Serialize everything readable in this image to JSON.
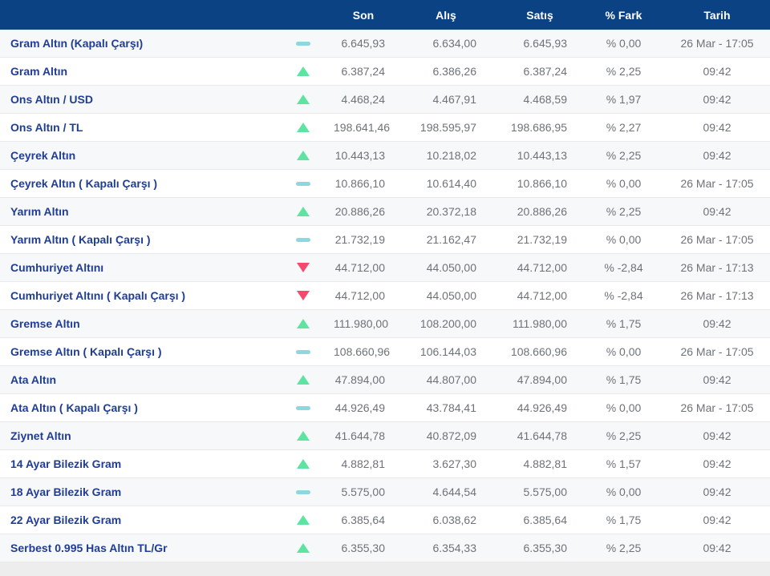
{
  "table": {
    "columns": [
      "Son",
      "Alış",
      "Satış",
      "% Fark",
      "Tarih"
    ],
    "trend_icons": {
      "up": "triangle-up",
      "down": "triangle-down",
      "flat": "dash"
    },
    "rows": [
      {
        "name": "Gram Altın (Kapalı Çarşı)",
        "trend": "flat",
        "son": "6.645,93",
        "alis": "6.634,00",
        "satis": "6.645,93",
        "fark": "% 0,00",
        "tarih": "26 Mar - 17:05"
      },
      {
        "name": "Gram Altın",
        "trend": "up",
        "son": "6.387,24",
        "alis": "6.386,26",
        "satis": "6.387,24",
        "fark": "% 2,25",
        "tarih": "09:42"
      },
      {
        "name": "Ons Altın / USD",
        "trend": "up",
        "son": "4.468,24",
        "alis": "4.467,91",
        "satis": "4.468,59",
        "fark": "% 1,97",
        "tarih": "09:42"
      },
      {
        "name": "Ons Altın / TL",
        "trend": "up",
        "son": "198.641,46",
        "alis": "198.595,97",
        "satis": "198.686,95",
        "fark": "% 2,27",
        "tarih": "09:42"
      },
      {
        "name": "Çeyrek Altın",
        "trend": "up",
        "son": "10.443,13",
        "alis": "10.218,02",
        "satis": "10.443,13",
        "fark": "% 2,25",
        "tarih": "09:42"
      },
      {
        "name": "Çeyrek Altın ( Kapalı Çarşı )",
        "trend": "flat",
        "son": "10.866,10",
        "alis": "10.614,40",
        "satis": "10.866,10",
        "fark": "% 0,00",
        "tarih": "26 Mar - 17:05"
      },
      {
        "name": "Yarım Altın",
        "trend": "up",
        "son": "20.886,26",
        "alis": "20.372,18",
        "satis": "20.886,26",
        "fark": "% 2,25",
        "tarih": "09:42"
      },
      {
        "name": "Yarım Altın ( Kapalı Çarşı )",
        "trend": "flat",
        "son": "21.732,19",
        "alis": "21.162,47",
        "satis": "21.732,19",
        "fark": "% 0,00",
        "tarih": "26 Mar - 17:05"
      },
      {
        "name": "Cumhuriyet Altını",
        "trend": "down",
        "son": "44.712,00",
        "alis": "44.050,00",
        "satis": "44.712,00",
        "fark": "% -2,84",
        "tarih": "26 Mar - 17:13"
      },
      {
        "name": "Cumhuriyet Altını ( Kapalı Çarşı )",
        "trend": "down",
        "son": "44.712,00",
        "alis": "44.050,00",
        "satis": "44.712,00",
        "fark": "% -2,84",
        "tarih": "26 Mar - 17:13"
      },
      {
        "name": "Gremse Altın",
        "trend": "up",
        "son": "111.980,00",
        "alis": "108.200,00",
        "satis": "111.980,00",
        "fark": "% 1,75",
        "tarih": "09:42"
      },
      {
        "name": "Gremse Altın ( Kapalı Çarşı )",
        "trend": "flat",
        "son": "108.660,96",
        "alis": "106.144,03",
        "satis": "108.660,96",
        "fark": "% 0,00",
        "tarih": "26 Mar - 17:05"
      },
      {
        "name": "Ata Altın",
        "trend": "up",
        "son": "47.894,00",
        "alis": "44.807,00",
        "satis": "47.894,00",
        "fark": "% 1,75",
        "tarih": "09:42"
      },
      {
        "name": "Ata Altın ( Kapalı Çarşı )",
        "trend": "flat",
        "son": "44.926,49",
        "alis": "43.784,41",
        "satis": "44.926,49",
        "fark": "% 0,00",
        "tarih": "26 Mar - 17:05"
      },
      {
        "name": "Ziynet Altın",
        "trend": "up",
        "son": "41.644,78",
        "alis": "40.872,09",
        "satis": "41.644,78",
        "fark": "% 2,25",
        "tarih": "09:42"
      },
      {
        "name": "14 Ayar Bilezik Gram",
        "trend": "up",
        "son": "4.882,81",
        "alis": "3.627,30",
        "satis": "4.882,81",
        "fark": "% 1,57",
        "tarih": "09:42"
      },
      {
        "name": "18 Ayar Bilezik Gram",
        "trend": "flat",
        "son": "5.575,00",
        "alis": "4.644,54",
        "satis": "5.575,00",
        "fark": "% 0,00",
        "tarih": "09:42"
      },
      {
        "name": "22 Ayar Bilezik Gram",
        "trend": "up",
        "son": "6.385,64",
        "alis": "6.038,62",
        "satis": "6.385,64",
        "fark": "% 1,75",
        "tarih": "09:42"
      },
      {
        "name": "Serbest 0.995 Has Altın TL/Gr",
        "trend": "up",
        "son": "6.355,30",
        "alis": "6.354,33",
        "satis": "6.355,30",
        "fark": "% 2,25",
        "tarih": "09:42"
      }
    ]
  },
  "colors": {
    "header_bg": "#0b4283",
    "header_text": "#ffffff",
    "instrument_link": "#203d96",
    "value_text": "#6e7278",
    "trend_up": "#5fe3a1",
    "trend_down": "#f5486d",
    "trend_flat": "#8dd7df",
    "row_alt_bg": "#f7f8f9",
    "row_border": "#e9e9ea",
    "footer_bg": "#ededee"
  }
}
